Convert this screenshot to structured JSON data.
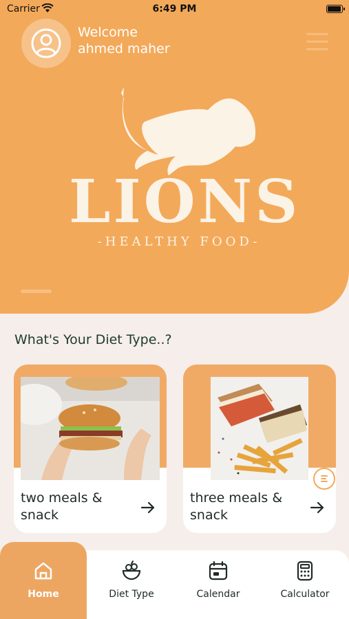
{
  "status_bar": {
    "carrier": "Carrier",
    "time": "6:49 PM"
  },
  "header": {
    "welcome": "Welcome",
    "user_name": "ahmed maher"
  },
  "hero": {
    "logo_title": "LIONS",
    "logo_subtitle": "-HEALTHY FOOD-"
  },
  "section": {
    "title": "What's Your Diet Type..?"
  },
  "cards": [
    {
      "label": "two meals & snack",
      "image": "burger-photo"
    },
    {
      "label": "three meals & snack",
      "image": "sandwich-fries-photo"
    }
  ],
  "tabs": [
    {
      "label": "Home",
      "icon": "home-icon",
      "active": true
    },
    {
      "label": "Diet Type",
      "icon": "salad-bowl-icon",
      "active": false
    },
    {
      "label": "Calendar",
      "icon": "calendar-icon",
      "active": false
    },
    {
      "label": "Calculator",
      "icon": "calculator-icon",
      "active": false
    }
  ],
  "colors": {
    "primary": "#f3a95a",
    "background": "#f6eeea",
    "text": "#1f2a24"
  }
}
